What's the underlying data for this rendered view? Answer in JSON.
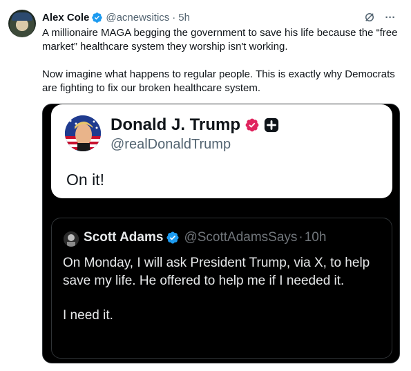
{
  "tweet": {
    "author_name": "Alex Cole",
    "handle": "@acnewsitics",
    "separator": "·",
    "time": "5h",
    "more_label": "···",
    "paragraphs": [
      "A millionaire MAGA begging the government to save his life because the “free market” healthcare system they worship isn't working.",
      "Now imagine what happens to regular people. This is exactly why Democrats are fighting to fix our broken healthcare system."
    ]
  },
  "embedded_image": {
    "trump_post": {
      "name": "Donald J. Trump",
      "handle": "@realDonaldTrump",
      "text": "On it!"
    },
    "adams_post": {
      "name": "Scott Adams",
      "handle": "@ScottAdamsSays",
      "separator": "·",
      "time": "10h",
      "paragraphs": [
        "On Monday, I will ask President Trump, via X, to help save my life. He offered to help me if I needed it.",
        "I need it."
      ]
    }
  },
  "colors": {
    "verified_blue": "#1d9bf0",
    "truth_badge_pink": "#e0245e",
    "secondary_text": "#536471"
  },
  "icons": [
    "verified-badge-icon",
    "grok-icon",
    "more-icon",
    "truth-verified-icon",
    "truth-plus-icon"
  ]
}
